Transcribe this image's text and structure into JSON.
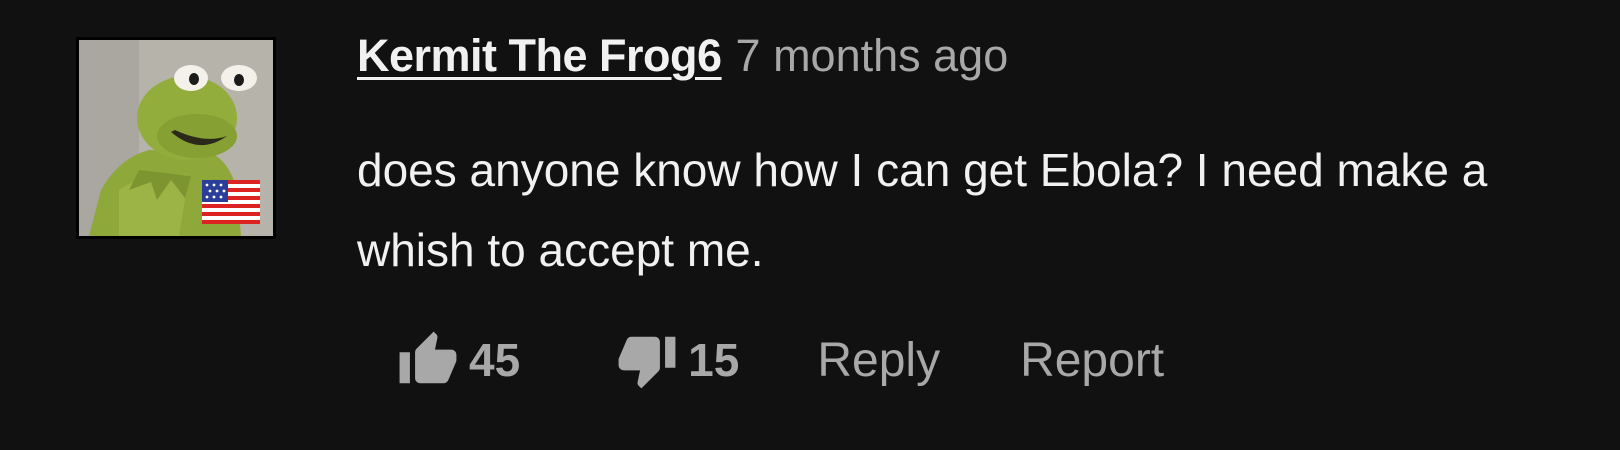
{
  "comment": {
    "author": "Kermit The Frog6",
    "timestamp": "7 months ago",
    "text": "does anyone know how I can get Ebola? I need make a whish to accept me.",
    "avatar": {
      "icon": "kermit-avatar",
      "flag": "us-flag-icon"
    },
    "actions": {
      "likes": "45",
      "dislikes": "15",
      "reply_label": "Reply",
      "report_label": "Report"
    }
  },
  "colors": {
    "background": "#111111",
    "text_primary": "#f1f1f1",
    "text_secondary": "#a8a8a8",
    "avatar_background": "#b5b3aa",
    "frog_green": "#8fa83a"
  }
}
